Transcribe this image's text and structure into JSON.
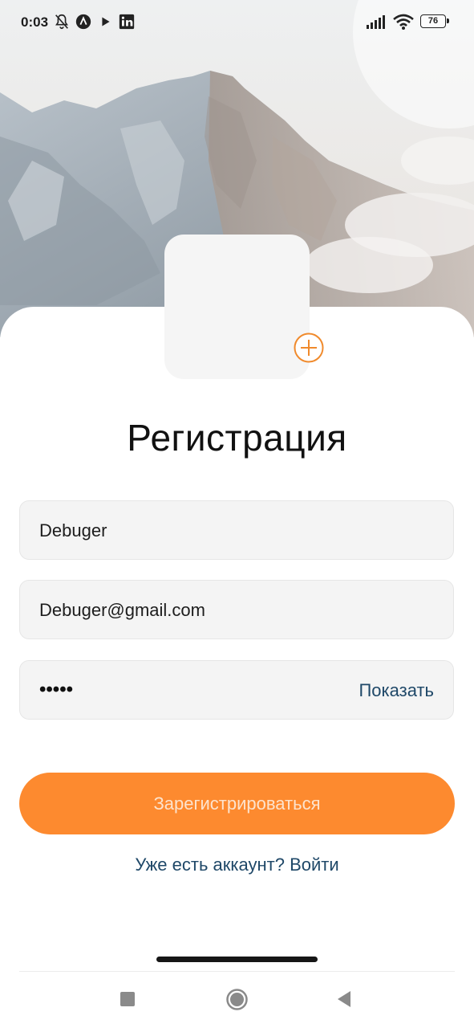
{
  "status_bar": {
    "time": "0:03",
    "battery": "76",
    "icons": [
      "bell-off-icon",
      "app-a-icon",
      "play-icon",
      "linkedin-icon",
      "signal-icon",
      "wifi-icon",
      "battery-icon"
    ]
  },
  "hero": {
    "image": "mountain-peaks-photo"
  },
  "avatar": {
    "add_icon": "plus-circle-icon"
  },
  "title": "Регистрация",
  "form": {
    "name_value": "Debuger",
    "email_value": "Debuger@gmail.com",
    "password_mask": "•••••",
    "show_label": "Показать"
  },
  "register_button": "Зарегистрироваться",
  "login_link": "Уже есть аккаунт? Войти",
  "colors": {
    "accent": "#fd8a2f",
    "link": "#1f4868",
    "field_bg": "#f4f4f4"
  },
  "nav": {
    "icons": [
      "recent-apps-icon",
      "home-icon",
      "back-icon"
    ]
  }
}
